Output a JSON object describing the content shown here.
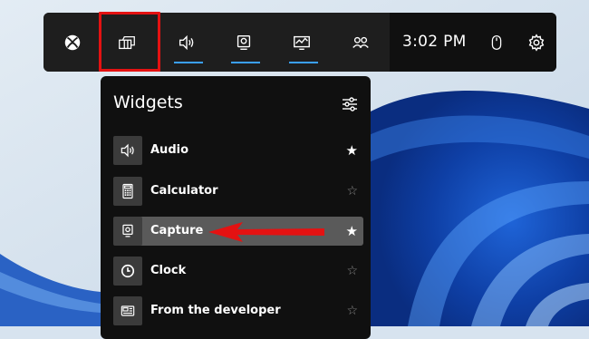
{
  "top_bar": {
    "time": "3:02 PM",
    "buttons": [
      {
        "icon": "xbox-logo-icon"
      },
      {
        "icon": "widget-menu-icon"
      },
      {
        "icon": "speaker-icon"
      },
      {
        "icon": "capture-icon"
      },
      {
        "icon": "performance-icon"
      },
      {
        "icon": "social-icon"
      }
    ],
    "right_icons": [
      "mouse-icon",
      "gear-icon"
    ],
    "accent": "#3aa0ff",
    "highlight_color": "#e41212"
  },
  "widgets_panel": {
    "title": "Widgets",
    "items": [
      {
        "label": "Audio",
        "favorite": true,
        "icon": "speaker-icon"
      },
      {
        "label": "Calculator",
        "favorite": false,
        "icon": "calculator-icon"
      },
      {
        "label": "Capture",
        "favorite": true,
        "icon": "capture-icon",
        "selected": true
      },
      {
        "label": "Clock",
        "favorite": false,
        "icon": "clock-icon"
      },
      {
        "label": "From the developer",
        "favorite": false,
        "icon": "developer-icon"
      }
    ],
    "star_on": "★",
    "star_off": "☆"
  }
}
